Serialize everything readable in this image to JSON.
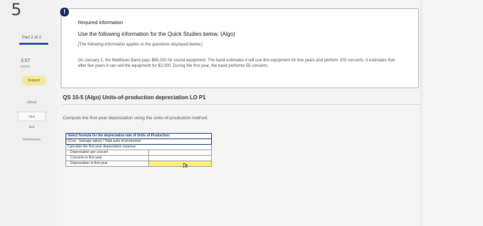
{
  "rail": {
    "question_number": "5",
    "part_label": "Part 2 of 2",
    "points_value": "3.57",
    "points_label": "points",
    "status": "Skipped",
    "tools": [
      "eBook",
      "Hint",
      "Ask",
      "References"
    ]
  },
  "info": {
    "title": "Required information",
    "heading": "Use the following information for the Quick Studies below. (Algo)",
    "note": "[The following information applies to the questions displayed below.]",
    "body": "On January 1, the Matthews Band pays $66,200 for sound equipment. The band estimates it will use this equipment for five years and perform 200 concerts. It estimates that after five years it can sell the equipment for $2,000. During the first year, the band performs 55 concerts."
  },
  "question": {
    "title": "QS 10-5 (Algo) Units-of-production depreciation LO P1",
    "prompt": "Compute the first-year depreciation using the units-of-production method."
  },
  "worksheet": {
    "header": "Select formula for the depreciation rate of Units of Production:",
    "formula": "(Cost - Salvage value) / Total units of production",
    "calc_label": "Calculate the first year depreciation expense:",
    "rows": [
      {
        "label": "Depreciation per concert",
        "value": ""
      },
      {
        "label": "Concerts in first year",
        "value": ""
      },
      {
        "label": "Depreciation in first year",
        "value": ""
      }
    ]
  },
  "colors": {
    "accent": "#1f3d86",
    "status_badge": "#f4e89a",
    "input_highlight": "#fff07a"
  }
}
